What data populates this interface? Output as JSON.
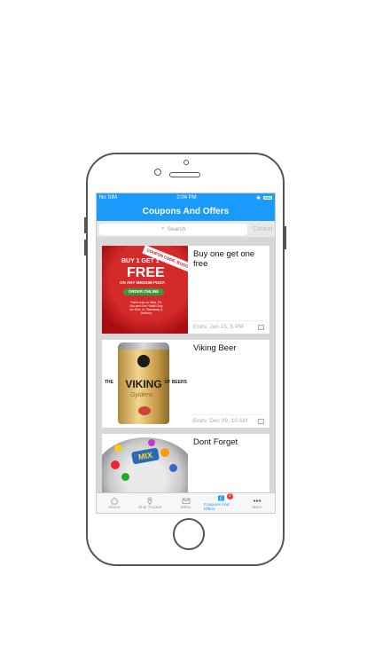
{
  "status_bar": {
    "carrier": "No SIM",
    "time": "2:04 PM"
  },
  "nav": {
    "title": "Coupons And Offers"
  },
  "search": {
    "placeholder": "Search",
    "cancel_label": "Cancel"
  },
  "offers": [
    {
      "title": "Buy one get one free",
      "ends": "Ends: Jun 15, 5 PM",
      "image": {
        "ribbon": "COUPON CODE: BOGO1",
        "line1": "BUY 1 GET 1",
        "line2": "FREE",
        "line3": "ON ANY MEDIUM PIZZA",
        "button": "ORDER ONLINE",
        "fine_print": "*Valid only on Wed, Fri, Sat and Sun *Valid Only for Dine In, Takeaway & Delivery"
      }
    },
    {
      "title": "Viking Beer",
      "ends": "Ends: Dec 09, 10 AM",
      "image": {
        "brand": "VIKING",
        "left": "THE",
        "right": "OF BEERS",
        "script": "Gyldenz"
      }
    },
    {
      "title": "Dont Forget",
      "ends": "",
      "image": {
        "brand": "MIX"
      }
    }
  ],
  "tabs": [
    {
      "label": "Home",
      "icon": "home-icon"
    },
    {
      "label": "Ship Tracker",
      "icon": "location-pin-icon"
    },
    {
      "label": "Inbox",
      "icon": "envelope-icon"
    },
    {
      "label": "Coupons And Offers",
      "icon": "coupon-icon",
      "badge": "3",
      "active": true
    },
    {
      "label": "More",
      "icon": "more-dots-icon"
    }
  ],
  "colors": {
    "primary": "#1a9bfb",
    "badge": "#ee3333"
  }
}
